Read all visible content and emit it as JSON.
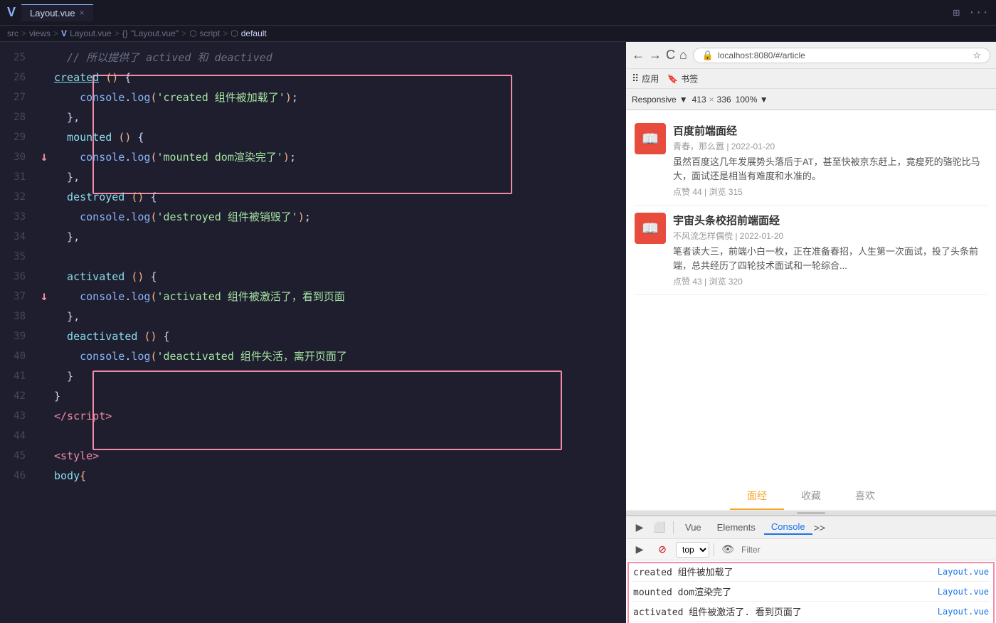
{
  "topbar": {
    "logo": "V",
    "tab_label": "Layout.vue",
    "tab_close": "×",
    "action_split": "⊞",
    "action_more": "···"
  },
  "breadcrumb": {
    "parts": [
      "src",
      ">",
      "views",
      ">",
      "V",
      "Layout.vue",
      ">",
      "{}",
      "\"Layout.vue\"",
      ">",
      "⬡",
      "script",
      ">",
      "⬡",
      "default"
    ]
  },
  "code": {
    "lines": [
      {
        "num": "25",
        "arrow": "",
        "content_html": "  <span class='comment'>// 所以提供了 actived 和 deactived</span>"
      },
      {
        "num": "26",
        "arrow": "",
        "content_html": "  <span class='fn-name'>created</span><span class='plain'> </span><span class='paren'>()</span><span class='plain'> {</span>"
      },
      {
        "num": "27",
        "arrow": "",
        "content_html": "    <span class='method'>console</span><span class='plain'>.</span><span class='method'>log</span><span class='paren'>(</span><span class='string'>'created 组件被加载了'</span><span class='paren'>)</span><span class='plain'>;</span>"
      },
      {
        "num": "28",
        "arrow": "",
        "content_html": "  <span class='plain'>},</span>"
      },
      {
        "num": "29",
        "arrow": "",
        "content_html": "  <span class='fn-name-plain'>mounted</span><span class='plain'> </span><span class='paren'>()</span><span class='plain'> {</span>"
      },
      {
        "num": "30",
        "arrow": "↓",
        "content_html": "    <span class='method'>console</span><span class='plain'>.</span><span class='method'>log</span><span class='paren'>(</span><span class='string'>'mounted dom渲染完了'</span><span class='paren'>)</span><span class='plain'>;</span>"
      },
      {
        "num": "31",
        "arrow": "",
        "content_html": "  <span class='plain'>},</span>"
      },
      {
        "num": "32",
        "arrow": "",
        "content_html": "  <span class='fn-name-plain'>destroyed</span><span class='plain'> </span><span class='paren'>()</span><span class='plain'> {</span>"
      },
      {
        "num": "33",
        "arrow": "",
        "content_html": "    <span class='method'>console</span><span class='plain'>.</span><span class='method'>log</span><span class='paren'>(</span><span class='string'>'destroyed 组件被销毁了'</span><span class='paren'>)</span><span class='plain'>;</span>"
      },
      {
        "num": "34",
        "arrow": "",
        "content_html": "  <span class='plain'>},</span>"
      },
      {
        "num": "35",
        "arrow": "",
        "content_html": ""
      },
      {
        "num": "36",
        "arrow": "",
        "content_html": "  <span class='fn-name-plain'>activated</span><span class='plain'> </span><span class='paren'>()</span><span class='plain'> {</span>"
      },
      {
        "num": "37",
        "arrow": "↓",
        "content_html": "    <span class='method'>console</span><span class='plain'>.</span><span class='method'>log</span><span class='paren'>(</span><span class='string'>'activated 组件被激活了，看到页面</span>"
      },
      {
        "num": "38",
        "arrow": "",
        "content_html": "  <span class='plain'>},</span>"
      },
      {
        "num": "39",
        "arrow": "",
        "content_html": "  <span class='fn-name-plain'>deactivated</span><span class='plain'> </span><span class='paren'>()</span><span class='plain'> {</span>"
      },
      {
        "num": "40",
        "arrow": "",
        "content_html": "    <span class='method'>console</span><span class='plain'>.</span><span class='method'>log</span><span class='paren'>(</span><span class='string'>'deactivated 组件失活，离开页面了</span>"
      },
      {
        "num": "41",
        "arrow": "",
        "content_html": "  <span class='plain'>}</span>"
      },
      {
        "num": "42",
        "arrow": "",
        "content_html": "<span class='plain'>}</span>"
      },
      {
        "num": "43",
        "arrow": "",
        "content_html": "<span class='tag'>&lt;/script&gt;</span>"
      },
      {
        "num": "44",
        "arrow": "",
        "content_html": ""
      },
      {
        "num": "45",
        "arrow": "",
        "content_html": "<span class='tag'>&lt;style&gt;</span>"
      },
      {
        "num": "46",
        "arrow": "",
        "content_html": "<span class='fn-name-plain'>body</span><span class='bracket'>{</span>"
      }
    ]
  },
  "browser": {
    "nav_back": "←",
    "nav_fwd": "→",
    "nav_refresh": "C",
    "nav_home": "⌂",
    "lock_icon": "🔒",
    "url": "localhost:8080/#/article",
    "bookmark_icon": "☆",
    "apps_label": "应用",
    "bookmarks_label": "书签"
  },
  "devtools_bar": {
    "responsive_label": "Responsive",
    "width": "413",
    "height": "336",
    "zoom": "100%",
    "chevron": "▼"
  },
  "articles": [
    {
      "icon": "📖",
      "title": "百度前端面经",
      "meta": "青春，那么嚣 | 2022-01-20",
      "excerpt": "虽然百度这几年发展势头落后于AT，甚至快被京东赶上，竟瘦死的骆驼比马大，面试还是相当有难度和水准的。",
      "stats": "点赞 44 | 浏览 315"
    },
    {
      "icon": "📖",
      "title": "宇宙头条校招前端面经",
      "meta": "不风流怎样偶傥 | 2022-01-20",
      "excerpt": "笔者读大三，前端小白一枚，正在准备春招，人生第一次面试，投了头条前端，总共经历了四轮技术面试和一轮综合...",
      "stats": "点赞 43 | 浏览 320"
    }
  ],
  "tabs": [
    {
      "label": "面经",
      "active": true
    },
    {
      "label": "收藏",
      "active": false
    },
    {
      "label": "喜欢",
      "active": false
    }
  ],
  "devtools": {
    "tabs": [
      "Vue",
      "Elements",
      "Console"
    ],
    "active_tab": "Console",
    "top_context": "top",
    "filter_placeholder": "Filter",
    "console_lines": [
      {
        "text": "created 组件被加载了",
        "source": "Layout.vue"
      },
      {
        "text": "mounted dom渲染完了",
        "source": "Layout.vue"
      },
      {
        "text": "activated 组件被激活了. 看到页面了",
        "source": "Layout.vue"
      }
    ]
  }
}
